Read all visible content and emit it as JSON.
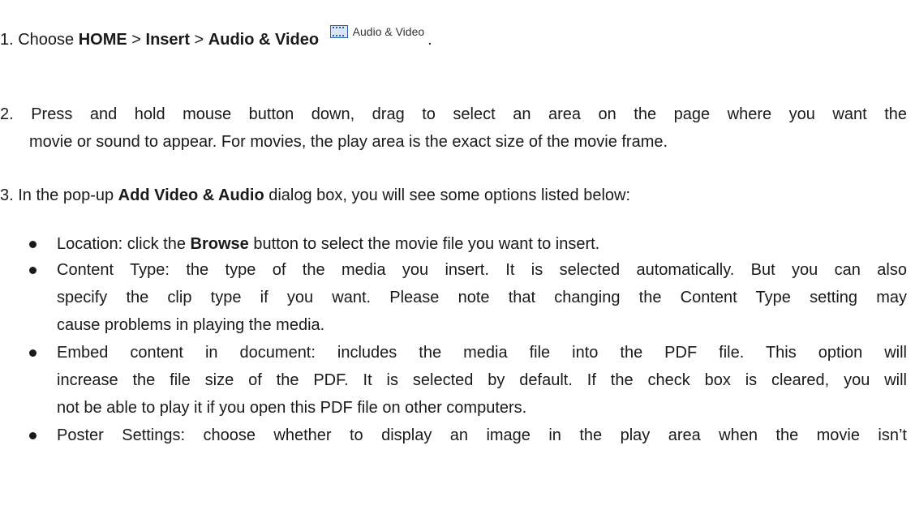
{
  "step1": {
    "prefix": "1. Choose ",
    "home": "HOME",
    "sep1": " > ",
    "insert": "Insert",
    "sep2": " > ",
    "audio_video": "Audio & Video",
    "button_label": "Audio & Video",
    "button_icon": "film-icon",
    "trailing": "."
  },
  "step2": {
    "line1": "2. Press and hold mouse button down, drag to select an area on the page where you want the",
    "line2": "movie or sound to appear. For movies, the play area is the exact size of the movie frame."
  },
  "step3": {
    "prefix": "3. In the pop-up ",
    "dialog": "Add Video & Audio",
    "suffix": " dialog box, you will see some options listed below:"
  },
  "bullets": {
    "b1": {
      "pre": "Location: click the ",
      "bold": "Browse",
      "post": " button to select the movie file you want to insert."
    },
    "b2": {
      "line1": "Content Type: the type of the media you insert. It is selected automatically. But you can also",
      "line2": "specify the clip type if you want. Please note that changing the Content Type setting may",
      "line3": "cause problems in playing the media."
    },
    "b3": {
      "line1": "Embed content in document: includes the media file into the PDF file. This option will",
      "line2": "increase the file size of the PDF. It is selected by default. If the check box is cleared, you will",
      "line3": "not be able to play it if you open this PDF file on other computers."
    },
    "b4": {
      "line1": "Poster Settings: choose whether to display an image in the play area when the movie isn’t"
    }
  }
}
